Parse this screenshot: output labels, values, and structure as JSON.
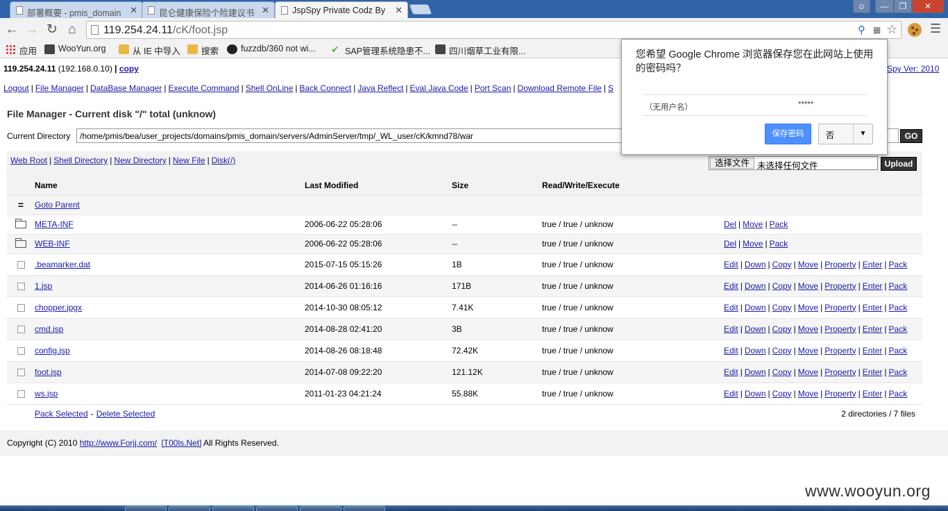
{
  "browser": {
    "tabs": [
      {
        "title": "部署概要 - pmis_domain",
        "active": false
      },
      {
        "title": "昆仑健康保险个险建议书",
        "active": false
      },
      {
        "title": "JspSpy Private Codz By",
        "active": true
      }
    ],
    "url_host": "119.254.24.11",
    "url_path": "/cK/foot.jsp",
    "bookmarks": [
      {
        "label": "应用",
        "icon": "apps-grid-icon"
      },
      {
        "label": "WooYun.org",
        "icon": "site-icon"
      },
      {
        "label": "从 IE 中导入",
        "icon": "folder-icon"
      },
      {
        "label": "搜索",
        "icon": "folder-icon"
      },
      {
        "label": "fuzzdb/360 not wi...",
        "icon": "github-icon"
      },
      {
        "label": "SAP管理系统隐患不...",
        "icon": "check-icon"
      },
      {
        "label": "四川烟草工业有限...",
        "icon": "site-icon"
      }
    ]
  },
  "header": {
    "host": "119.254.24.11",
    "ip": "(192.168.0.10)",
    "sep": "|",
    "copy_label": "copy",
    "version": "Spy Ver: 2010"
  },
  "menu": [
    "Logout",
    "File Manager",
    "DataBase Manager",
    "Execute Command",
    "Shell OnLine",
    "Back Connect",
    "Java Reflect",
    "Eval Java Code",
    "Port Scan",
    "Download Remote File",
    "S"
  ],
  "file_manager": {
    "title": "File Manager - Current disk \"/\" total (unknow)",
    "current_dir_label": "Current Directory",
    "current_dir_value": "/home/pmis/bea/user_projects/domains/pmis_domain/servers/AdminServer/tmp/_WL_user/cK/kmnd78/war",
    "go_label": "GO",
    "quick_links": [
      "Web Root",
      "Shell Directory",
      "New Directory",
      "New File",
      "Disk(/)"
    ],
    "choose_file_label": "选择文件",
    "no_file_label": "未选择任何文件",
    "upload_label": "Upload",
    "columns": [
      "Name",
      "Last Modified",
      "Size",
      "Read/Write/Execute"
    ],
    "goto_parent_icon": "=",
    "goto_parent_label": "Goto Parent",
    "directories": [
      {
        "name": "META-INF",
        "modified": "2006-06-22 05:28:06",
        "size": "--",
        "rwe": "true / true / unknow",
        "actions": [
          "Del",
          "Move",
          "Pack"
        ]
      },
      {
        "name": "WEB-INF",
        "modified": "2006-06-22 05:28:06",
        "size": "--",
        "rwe": "true / true / unknow",
        "actions": [
          "Del",
          "Move",
          "Pack"
        ]
      }
    ],
    "files": [
      {
        "name": ".beamarker.dat",
        "modified": "2015-07-15 05:15:26",
        "size": "1B",
        "rwe": "true / true / unknow"
      },
      {
        "name": "1.jsp",
        "modified": "2014-06-26 01:16:16",
        "size": "171B",
        "rwe": "true / true / unknow"
      },
      {
        "name": "chopper.jpgx",
        "modified": "2014-10-30 08:05:12",
        "size": "7.41K",
        "rwe": "true / true / unknow"
      },
      {
        "name": "cmd.jsp",
        "modified": "2014-08-28 02:41:20",
        "size": "3B",
        "rwe": "true / true / unknow"
      },
      {
        "name": "config.jsp",
        "modified": "2014-08-26 08:18:48",
        "size": "72.42K",
        "rwe": "true / true / unknow"
      },
      {
        "name": "foot.jsp",
        "modified": "2014-07-08 09:22:20",
        "size": "121.12K",
        "rwe": "true / true / unknow"
      },
      {
        "name": "ws.jsp",
        "modified": "2011-01-23 04:21:24",
        "size": "55.88K",
        "rwe": "true / true / unknow"
      }
    ],
    "file_actions": [
      "Edit",
      "Down",
      "Copy",
      "Move",
      "Property",
      "Enter",
      "Pack"
    ],
    "pack_selected_label": "Pack Selected",
    "dash": "-",
    "delete_selected_label": "Delete Selected",
    "summary": "2 directories / 7 files"
  },
  "footer": {
    "prefix": "Copyright (C) 2010",
    "link1": "http://www.Forjj.com/",
    "link2": "[T00ls.Net]",
    "suffix": "All Rights Reserved."
  },
  "password_bubble": {
    "question": "您希望 Google Chrome 浏览器保存您在此网站上使用的密码吗？",
    "username": "（无用户名）",
    "password_mask": "*****",
    "save_label": "保存密码",
    "no_label": "否"
  },
  "watermark": "www.wooyun.org"
}
